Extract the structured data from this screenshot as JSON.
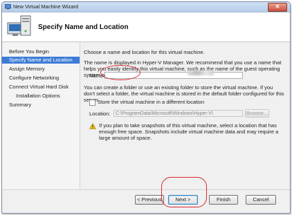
{
  "window": {
    "title": "New Virtual Machine Wizard"
  },
  "header": {
    "title": "Specify Name and Location",
    "icon": "vm-wizard-icon"
  },
  "sidebar": {
    "items": [
      {
        "label": "Before You Begin",
        "active": false,
        "sub": false
      },
      {
        "label": "Specify Name and Location",
        "active": true,
        "sub": false
      },
      {
        "label": "Assign Memory",
        "active": false,
        "sub": false
      },
      {
        "label": "Configure Networking",
        "active": false,
        "sub": false
      },
      {
        "label": "Connect Virtual Hard Disk",
        "active": false,
        "sub": false
      },
      {
        "label": "Installation Options",
        "active": false,
        "sub": true
      },
      {
        "label": "Summary",
        "active": false,
        "sub": false
      }
    ]
  },
  "main": {
    "intro": "Choose a name and location for this virtual machine.",
    "desc": "The name is displayed in Hyper-V Manager. We recommend that you use a name that helps you easily identify this virtual machine, such as the name of the guest operating system or workload.",
    "name_label": "Name:",
    "folder_desc": "You can create a folder or use an existing folder to store the virtual machine. If you don't select a folder, the virtual machine is stored in the default folder configured for this server.",
    "store_checkbox_label": "Store the virtual machine in a different location",
    "location_label": "Location:",
    "location_value": "C:\\ProgramData\\Microsoft\\Windows\\Hyper-V\\",
    "browse_label": "Browse...",
    "warning": "If you plan to take snapshots of this virtual machine, select a location that has enough free space. Snapshots include virtual machine data and may require a large amount of space."
  },
  "buttons": {
    "previous": "< Previous",
    "next": "Next >",
    "finish": "Finish",
    "cancel": "Cancel"
  },
  "colors": {
    "accent": "#3d7bd6",
    "annotation": "#d9262b"
  }
}
